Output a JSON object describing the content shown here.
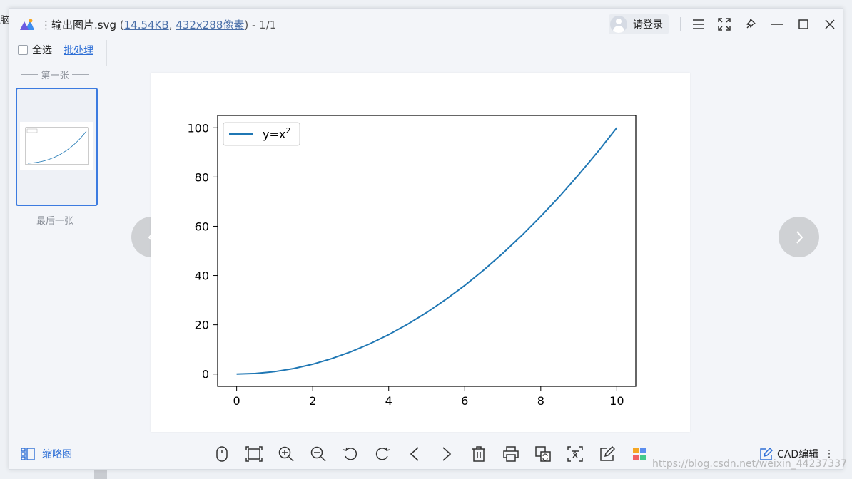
{
  "behind_window": {
    "edge_text": "脑"
  },
  "titlebar": {
    "file_name": "输出图片.svg",
    "open_paren": " (",
    "file_size": "14.54KB",
    "comma": ",",
    "dimensions": "432x288像素",
    "page_count": ") - 1/1",
    "login_label": "请登录"
  },
  "selection": {
    "select_all": "全选",
    "batch": "批处理"
  },
  "thumbnails": {
    "first_label": "第一张",
    "last_label": "最后一张"
  },
  "chart_data": {
    "type": "line",
    "series": [
      {
        "name": "y=x²",
        "legend_base": "y=x",
        "legend_sup": "2",
        "x": [
          0,
          0.5,
          1,
          1.5,
          2,
          2.5,
          3,
          3.5,
          4,
          4.5,
          5,
          5.5,
          6,
          6.5,
          7,
          7.5,
          8,
          8.5,
          9,
          9.5,
          10
        ],
        "y": [
          0,
          0.25,
          1,
          2.25,
          4,
          6.25,
          9,
          12.25,
          16,
          20.25,
          25,
          30.25,
          36,
          42.25,
          49,
          56.25,
          64,
          72.25,
          81,
          90.25,
          100
        ],
        "color": "#1f77b4"
      }
    ],
    "xticks": [
      "0",
      "2",
      "4",
      "6",
      "8",
      "10"
    ],
    "yticks": [
      "0",
      "20",
      "40",
      "60",
      "80",
      "100"
    ],
    "xlim": [
      -0.5,
      10.5
    ],
    "ylim": [
      -5,
      105
    ],
    "title": "",
    "xlabel": "",
    "ylabel": "",
    "legend_placement": "top-left",
    "grid": false
  },
  "bottom_toolbar": {
    "thumbs_label": "缩略图",
    "tools": [
      "mouse-icon",
      "fit-screen-icon",
      "zoom-in-icon",
      "zoom-out-icon",
      "rotate-left-icon",
      "rotate-right-icon",
      "previous-icon",
      "next-icon",
      "delete-icon",
      "print-icon",
      "convert-icon",
      "ocr-icon",
      "edit-icon",
      "apps-icon"
    ],
    "cad_label": "CAD编辑",
    "more": "⋮"
  },
  "watermark": "https://blog.csdn.net/weixin_44237337",
  "colors": {
    "accent": "#2e6fd6",
    "line": "#1f77b4",
    "thumb_border": "#3c7be0"
  }
}
